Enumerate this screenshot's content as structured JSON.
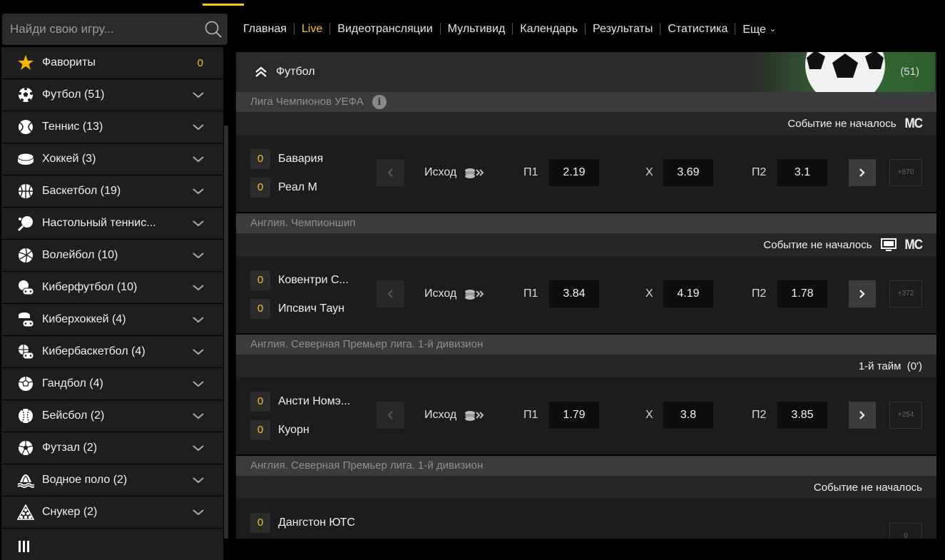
{
  "search": {
    "placeholder": "Найди свою игру..."
  },
  "nav": {
    "items": [
      {
        "label": "Главная"
      },
      {
        "label": "Live"
      },
      {
        "label": "Видеотрансляции"
      },
      {
        "label": "Мультивид"
      },
      {
        "label": "Календарь"
      },
      {
        "label": "Результаты"
      },
      {
        "label": "Статистика"
      },
      {
        "label": "Еще"
      }
    ]
  },
  "sidebar": {
    "items": [
      {
        "label": "Фавориты",
        "count": "0",
        "icon": "star-icon"
      },
      {
        "label": "Футбол (51)",
        "icon": "soccer-ball-icon"
      },
      {
        "label": "Теннис (13)",
        "icon": "tennis-ball-icon"
      },
      {
        "label": "Хоккей (3)",
        "icon": "hockey-puck-icon"
      },
      {
        "label": "Баскетбол (19)",
        "icon": "basketball-icon"
      },
      {
        "label": "Настольный теннис...",
        "icon": "ping-pong-icon"
      },
      {
        "label": "Волейбол (10)",
        "icon": "volleyball-icon"
      },
      {
        "label": "Киберфутбол (10)",
        "icon": "cyber-football-icon"
      },
      {
        "label": "Киберхоккей (4)",
        "icon": "cyber-hockey-icon"
      },
      {
        "label": "Кибербаскетбол (4)",
        "icon": "cyber-basketball-icon"
      },
      {
        "label": "Гандбол (4)",
        "icon": "handball-icon"
      },
      {
        "label": "Бейсбол (2)",
        "icon": "baseball-icon"
      },
      {
        "label": "Футзал (2)",
        "icon": "futsal-icon"
      },
      {
        "label": "Водное поло (2)",
        "icon": "water-polo-icon"
      },
      {
        "label": "Снукер (2)",
        "icon": "snooker-icon"
      }
    ]
  },
  "section": {
    "title": "Футбол",
    "total": "(51)"
  },
  "outcome_label": "Исход",
  "odd_labels": {
    "p1": "П1",
    "x": "X",
    "p2": "П2"
  },
  "events": [
    {
      "league": "Лига Чемпионов УЕФА",
      "status": "Событие не началось",
      "mc": "MC",
      "tv": false,
      "team1": {
        "name": "Бавария",
        "score": "0"
      },
      "team2": {
        "name": "Реал М",
        "score": "0"
      },
      "p1": "2.19",
      "x": "3.69",
      "p2": "3.1",
      "more": "+870"
    },
    {
      "league": "Англия. Чемпионшип",
      "status": "Событие не началось",
      "mc": "MC",
      "tv": true,
      "team1": {
        "name": "Ковентри С...",
        "score": "0"
      },
      "team2": {
        "name": "Ипсвич Таун",
        "score": "0"
      },
      "p1": "3.84",
      "x": "4.19",
      "p2": "1.78",
      "more": "+372"
    },
    {
      "league": "Англия. Северная Премьер лига. 1-й дивизион",
      "status": "1-й тайм  (0')",
      "mc": "",
      "tv": false,
      "team1": {
        "name": "Ансти Номэ...",
        "score": "0"
      },
      "team2": {
        "name": "Куорн",
        "score": "0"
      },
      "p1": "1.79",
      "x": "3.8",
      "p2": "3.85",
      "more": "+254"
    },
    {
      "league": "Англия. Северная Премьер лига. 1-й дивизион",
      "status": "Событие не началось",
      "mc": "",
      "tv": false,
      "team1": {
        "name": "Дангстон ЮТС",
        "score": "0"
      },
      "more": "0"
    }
  ],
  "colors": {
    "accent": "#f5c518",
    "panel": "#1c1c1c",
    "league_bar": "#3b3b3b",
    "odd_box": "#0d0d0d"
  }
}
